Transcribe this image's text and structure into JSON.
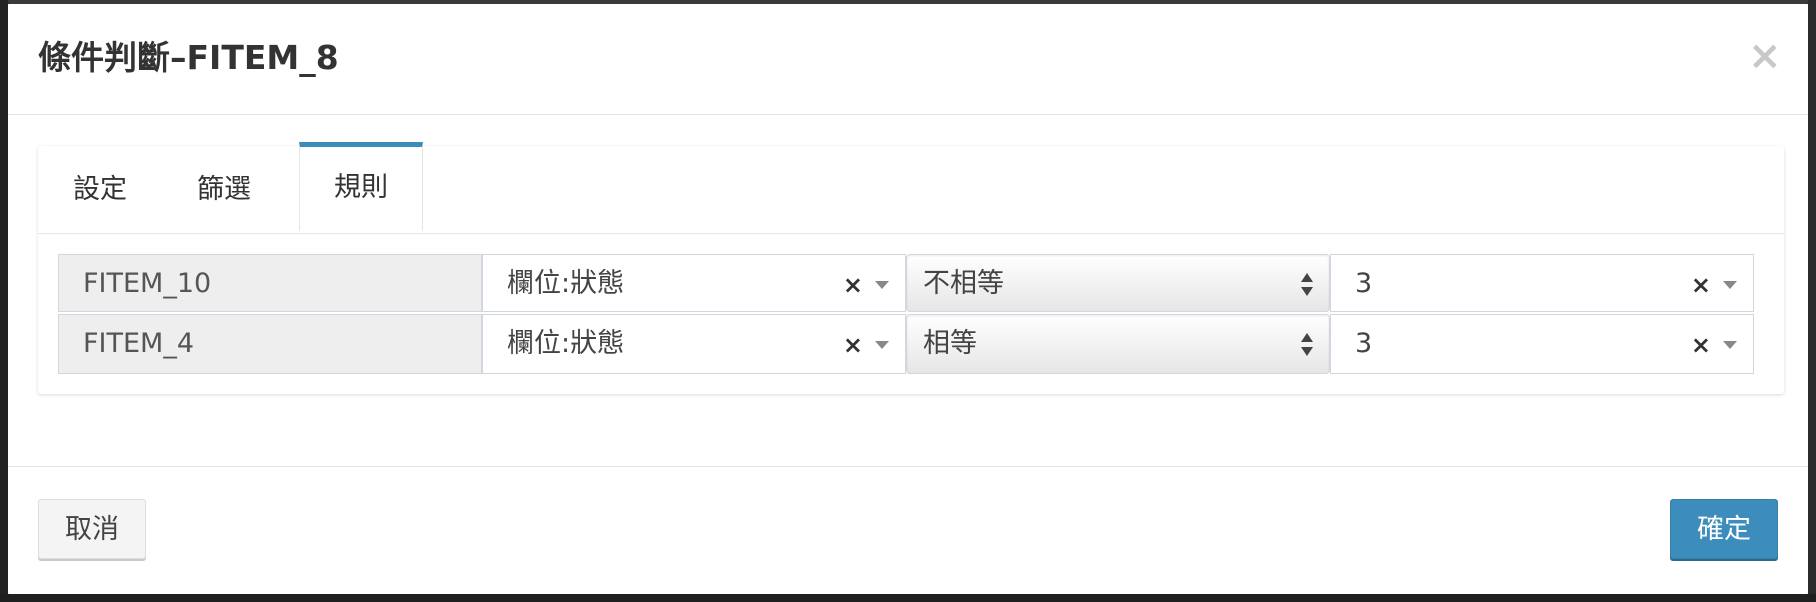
{
  "modal": {
    "title": "條件判斷–FITEM_8",
    "close_symbol": "×"
  },
  "tabs": [
    {
      "label": "設定",
      "active": false
    },
    {
      "label": "篩選",
      "active": false
    },
    {
      "label": "規則",
      "active": true
    }
  ],
  "rules": [
    {
      "name": "FITEM_10",
      "field": "欄位:狀態",
      "operator": "不相等",
      "value": "3"
    },
    {
      "name": "FITEM_4",
      "field": "欄位:狀態",
      "operator": "相等",
      "value": "3"
    }
  ],
  "icons": {
    "clear": "×"
  },
  "footer": {
    "cancel_label": "取消",
    "confirm_label": "確定"
  },
  "colors": {
    "accent": "#3c8dbc",
    "name_cell_bg": "#eeeeee"
  }
}
